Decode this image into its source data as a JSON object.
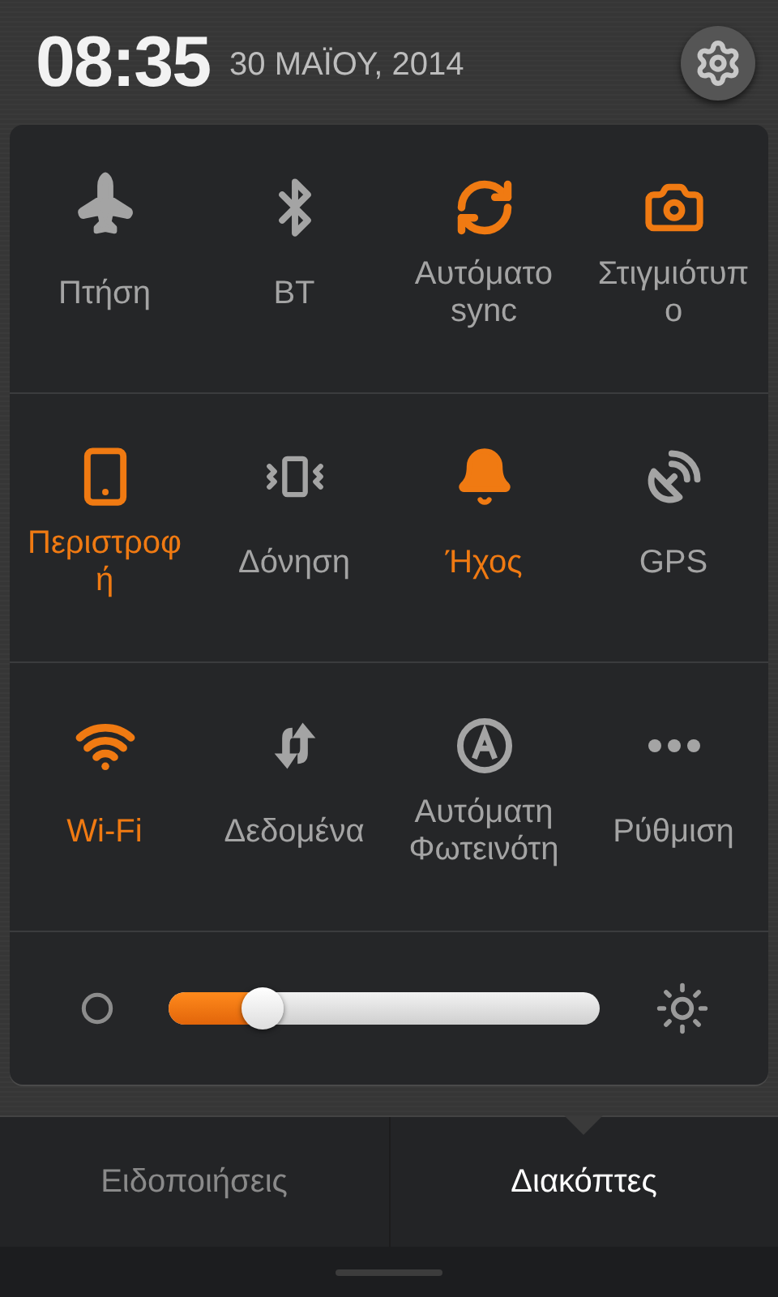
{
  "header": {
    "time": "08:35",
    "date": "30 ΜΑΪΟΥ, 2014"
  },
  "toggles": [
    {
      "kind": "airplane",
      "label": "Πτήση",
      "on": false,
      "label_active": false
    },
    {
      "kind": "bluetooth",
      "label": "BT",
      "on": false,
      "label_active": false
    },
    {
      "kind": "sync",
      "label": "Αυτόματο sync",
      "on": true,
      "label_active": false
    },
    {
      "kind": "screenshot",
      "label": "Στιγμιότυπο",
      "on": true,
      "label_active": false
    },
    {
      "kind": "rotate",
      "label": "Περιστροφή",
      "on": true,
      "label_active": true
    },
    {
      "kind": "vibrate",
      "label": "Δόνηση",
      "on": false,
      "label_active": false
    },
    {
      "kind": "bell",
      "label": "Ήχος",
      "on": true,
      "label_active": true
    },
    {
      "kind": "gps",
      "label": "GPS",
      "on": false,
      "label_active": false
    },
    {
      "kind": "wifi",
      "label": "Wi-Fi",
      "on": true,
      "label_active": true
    },
    {
      "kind": "data",
      "label": "Δεδομένα",
      "on": false,
      "label_active": false
    },
    {
      "kind": "auto_brightness",
      "label": "Αυτόματη Φωτεινότη",
      "on": false,
      "label_active": false
    },
    {
      "kind": "more",
      "label": "Ρύθμιση",
      "on": false,
      "label_active": false
    }
  ],
  "brightness": {
    "level": 0.17
  },
  "tabs": [
    {
      "label": "Ειδοποιήσεις",
      "selected": false
    },
    {
      "label": "Διακόπτες",
      "selected": true
    }
  ]
}
